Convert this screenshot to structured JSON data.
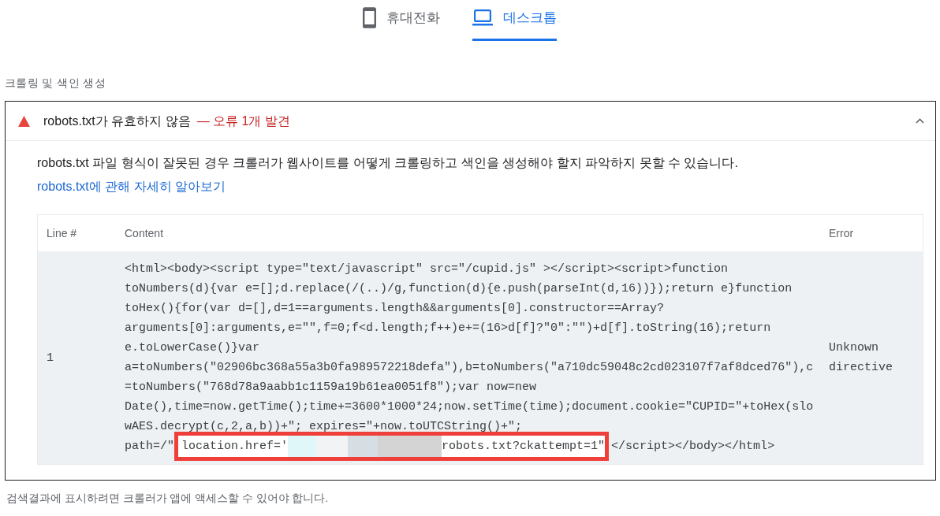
{
  "tabs": [
    {
      "label": "휴대전화",
      "kind": "phone",
      "selected": false
    },
    {
      "label": "데스크톱",
      "kind": "desktop",
      "selected": true
    }
  ],
  "section_title": "크롤링 및 색인 생성",
  "audit": {
    "title": "robots.txt가 유효하지 않음",
    "summary": "— 오류 1개 발견",
    "expanded": true,
    "description": "robots.txt 파일 형식이 잘못된 경우 크롤러가 웹사이트를 어떻게 크롤링하고 색인을 생성해야 할지 파악하지 못할 수 있습니다.",
    "link": "robots.txt에 관해 자세히 알아보기",
    "table": {
      "columns": [
        "Line #",
        "Content",
        "Error"
      ],
      "rows": [
        {
          "line": "1",
          "content": {
            "lines": [
              "<html><body><script type=\"text/javascript\" src=\"/cupid.js\" ></script><script>function",
              "toNumbers(d){var e=[];d.replace(/(..)/g,function(d){e.push(parseInt(d,16))});return e}function",
              "toHex(){for(var d=[],d=1==arguments.length&&arguments[0].constructor==Array?",
              "arguments[0]:arguments,e=\"\",f=0;f<d.length;f++)e+=(16>d[f]?\"0\":\"\")+d[f].toString(16);return",
              "e.toLowerCase()}var",
              "a=toNumbers(\"02906bc368a55a3b0fa989572218defa\"),b=toNumbers(\"a710dc59048c2cd023107f7af8dced76\"),c",
              "=toNumbers(\"768d78a9aabb1c1159a19b61ea0051f8\");var now=new",
              "Date(),time=now.getTime();time+=3600*1000*24;now.setTime(time);document.cookie=\"CUPID=\"+toHex(slo",
              "wAES.decrypt(c,2,a,b))+\"; expires=\"+now.toUTCString()+\";"
            ],
            "last_line": {
              "before": "path=/\"",
              "highlight_start": "location.href='",
              "highlight_end": "robots.txt?ckattempt=1\"",
              "after": "</script></body></html>"
            }
          },
          "error": "Unknown directive"
        }
      ]
    }
  },
  "footer": "검색결과에 표시하려면 크롤러가 앱에 액세스할 수 있어야 합니다."
}
